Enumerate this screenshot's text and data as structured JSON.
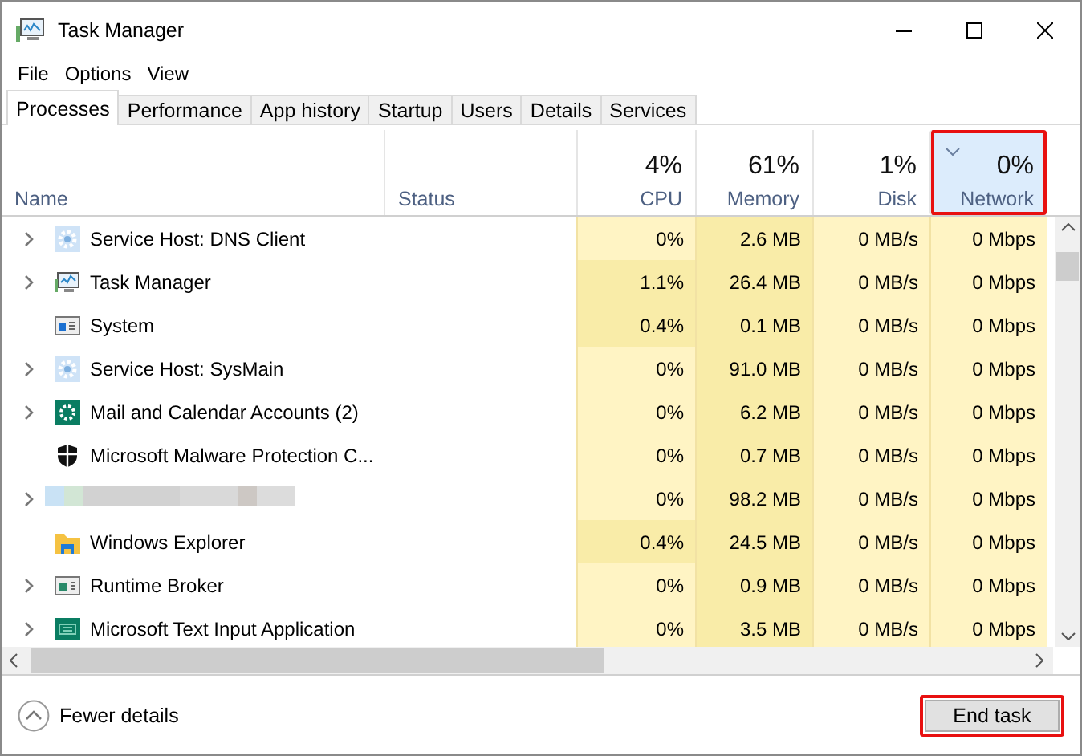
{
  "window": {
    "title": "Task Manager"
  },
  "menu": [
    "File",
    "Options",
    "View"
  ],
  "tabs": [
    {
      "label": "Processes",
      "selected": true
    },
    {
      "label": "Performance",
      "selected": false
    },
    {
      "label": "App history",
      "selected": false
    },
    {
      "label": "Startup",
      "selected": false
    },
    {
      "label": "Users",
      "selected": false
    },
    {
      "label": "Details",
      "selected": false
    },
    {
      "label": "Services",
      "selected": false
    }
  ],
  "columns": [
    {
      "label": "Name",
      "kind": "text"
    },
    {
      "label": "Status",
      "kind": "text"
    },
    {
      "kind": "metric",
      "percent": "4%",
      "label": "CPU",
      "hot": false,
      "sorted": false,
      "highlighted": false
    },
    {
      "kind": "metric",
      "percent": "61%",
      "label": "Memory",
      "hot": true,
      "sorted": false,
      "highlighted": false
    },
    {
      "kind": "metric",
      "percent": "1%",
      "label": "Disk",
      "hot": false,
      "sorted": false,
      "highlighted": false
    },
    {
      "kind": "metric",
      "percent": "0%",
      "label": "Network",
      "hot": false,
      "sorted": true,
      "highlighted": true
    }
  ],
  "rows": [
    {
      "kind": "process",
      "expandable": true,
      "name": "Service Host: DNS Client",
      "cpu": "0%",
      "cpu_hot": false,
      "memory": "2.6 MB",
      "disk": "0 MB/s",
      "network": "0 Mbps"
    },
    {
      "kind": "process",
      "expandable": true,
      "name": "Task Manager",
      "cpu": "1.1%",
      "cpu_hot": true,
      "memory": "26.4 MB",
      "disk": "0 MB/s",
      "network": "0 Mbps"
    },
    {
      "kind": "process",
      "expandable": false,
      "name": "System",
      "cpu": "0.4%",
      "cpu_hot": true,
      "memory": "0.1 MB",
      "disk": "0 MB/s",
      "network": "0 Mbps"
    },
    {
      "kind": "process",
      "expandable": true,
      "name": "Service Host: SysMain",
      "cpu": "0%",
      "cpu_hot": false,
      "memory": "91.0 MB",
      "disk": "0 MB/s",
      "network": "0 Mbps"
    },
    {
      "kind": "process",
      "expandable": true,
      "name": "Mail and Calendar Accounts (2)",
      "cpu": "0%",
      "cpu_hot": false,
      "memory": "6.2 MB",
      "disk": "0 MB/s",
      "network": "0 Mbps"
    },
    {
      "kind": "process",
      "expandable": false,
      "name": "Microsoft Malware Protection C...",
      "cpu": "0%",
      "cpu_hot": false,
      "memory": "0.7 MB",
      "disk": "0 MB/s",
      "network": "0 Mbps"
    },
    {
      "kind": "obscured",
      "expandable": true,
      "cpu": "0%",
      "cpu_hot": false,
      "memory": "98.2 MB",
      "disk": "0 MB/s",
      "network": "0 Mbps"
    },
    {
      "kind": "process",
      "expandable": false,
      "name": "Windows Explorer",
      "cpu": "0.4%",
      "cpu_hot": true,
      "memory": "24.5 MB",
      "disk": "0 MB/s",
      "network": "0 Mbps"
    },
    {
      "kind": "process",
      "expandable": true,
      "name": "Runtime Broker",
      "cpu": "0%",
      "cpu_hot": false,
      "memory": "0.9 MB",
      "disk": "0 MB/s",
      "network": "0 Mbps"
    },
    {
      "kind": "process",
      "expandable": true,
      "name": "Microsoft Text Input Application",
      "cpu": "0%",
      "cpu_hot": false,
      "memory": "3.5 MB",
      "disk": "0 MB/s",
      "network": "0 Mbps"
    }
  ],
  "footer": {
    "toggle": "Fewer details",
    "button": {
      "label": "End task",
      "highlighted": true
    }
  }
}
